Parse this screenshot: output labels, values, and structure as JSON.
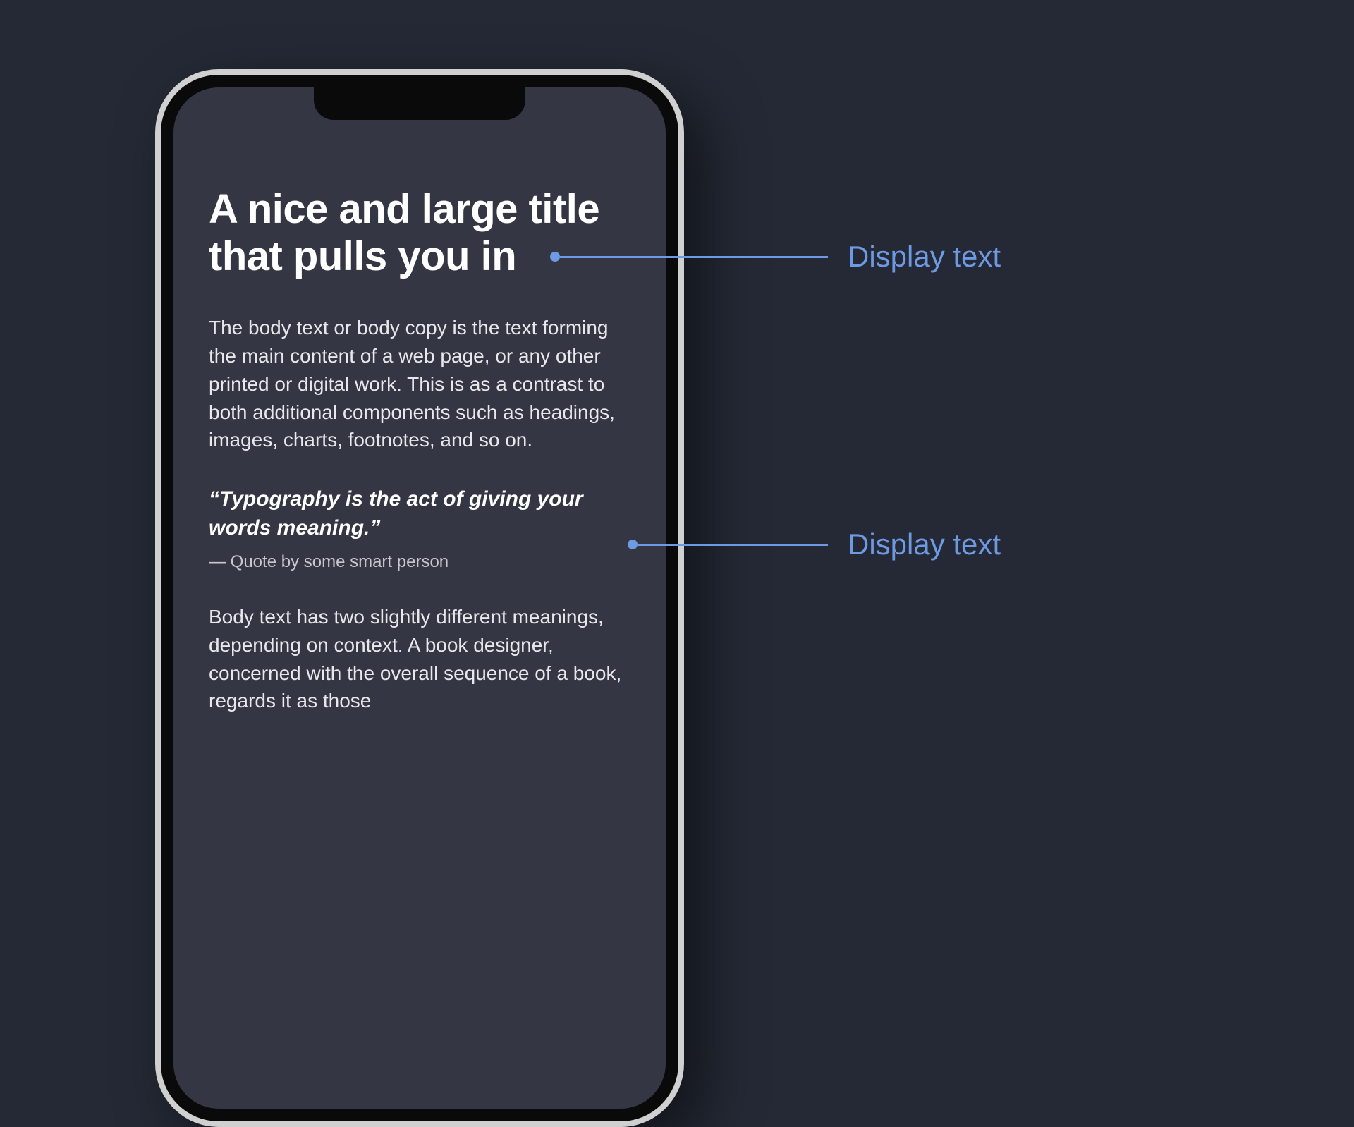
{
  "phone": {
    "title": "A nice and large title that pulls you in",
    "body1": "The body text or body copy is the text forming the main content of a web page, or any other printed or digital work. This is as a contrast to both additional components such as headings, images, charts, footnotes, and so on.",
    "quote": "“Typography is the act of giving your words meaning.”",
    "quote_attribution": "— Quote by some smart person",
    "body2": "Body text has two slightly different meanings, depending on context. A book designer, concerned with the overall sequence of a book, regards it as those"
  },
  "annotations": {
    "display_text_1": "Display text",
    "display_text_2": "Display text"
  },
  "colors": {
    "background": "#242935",
    "phone_screen": "#343743",
    "annotation": "#6d9ae3",
    "text_white": "#ffffff",
    "text_body": "#e8e8ec"
  }
}
